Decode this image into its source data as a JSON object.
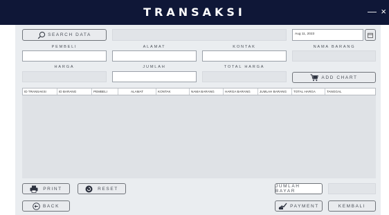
{
  "window": {
    "title": "TRANSAKSI",
    "minimize": "—",
    "close": "×"
  },
  "search": {
    "button_label": "SEARCH DATA",
    "icon": "search-icon",
    "input_value": ""
  },
  "date": {
    "value": "Aug 11, 2023",
    "icon": "calendar-icon"
  },
  "labels": {
    "pembeli": "PEMBELI",
    "alamat": "ALAMAT",
    "kontak": "KONTAK",
    "nama_barang": "NAMA BARANG",
    "harga": "HARGA",
    "jumlah": "JUMLAH",
    "total_harga": "TOTAL HARGA"
  },
  "buttons": {
    "add_chart": "ADD CHART",
    "print": "PRINT",
    "reset": "RESET",
    "back": "BACK",
    "jumlah_bayar": "JUMLAH BAYAR",
    "payment": "PAYMENT",
    "kembali": "KEMBALI"
  },
  "table": {
    "columns": [
      "ID TRANSAKSI",
      "ID BARANG",
      "PEMBELI",
      "ALAMAT",
      "KONTAK",
      "NAMA BARANG",
      "HARGA BARANG",
      "JUMLAH BARANG",
      "TOTAL HARGA",
      "TANGGAL"
    ],
    "rows": []
  },
  "colors": {
    "titlebar": "#0f1737",
    "panel": "#eaedf0",
    "table_bg": "#dfe2e6"
  }
}
